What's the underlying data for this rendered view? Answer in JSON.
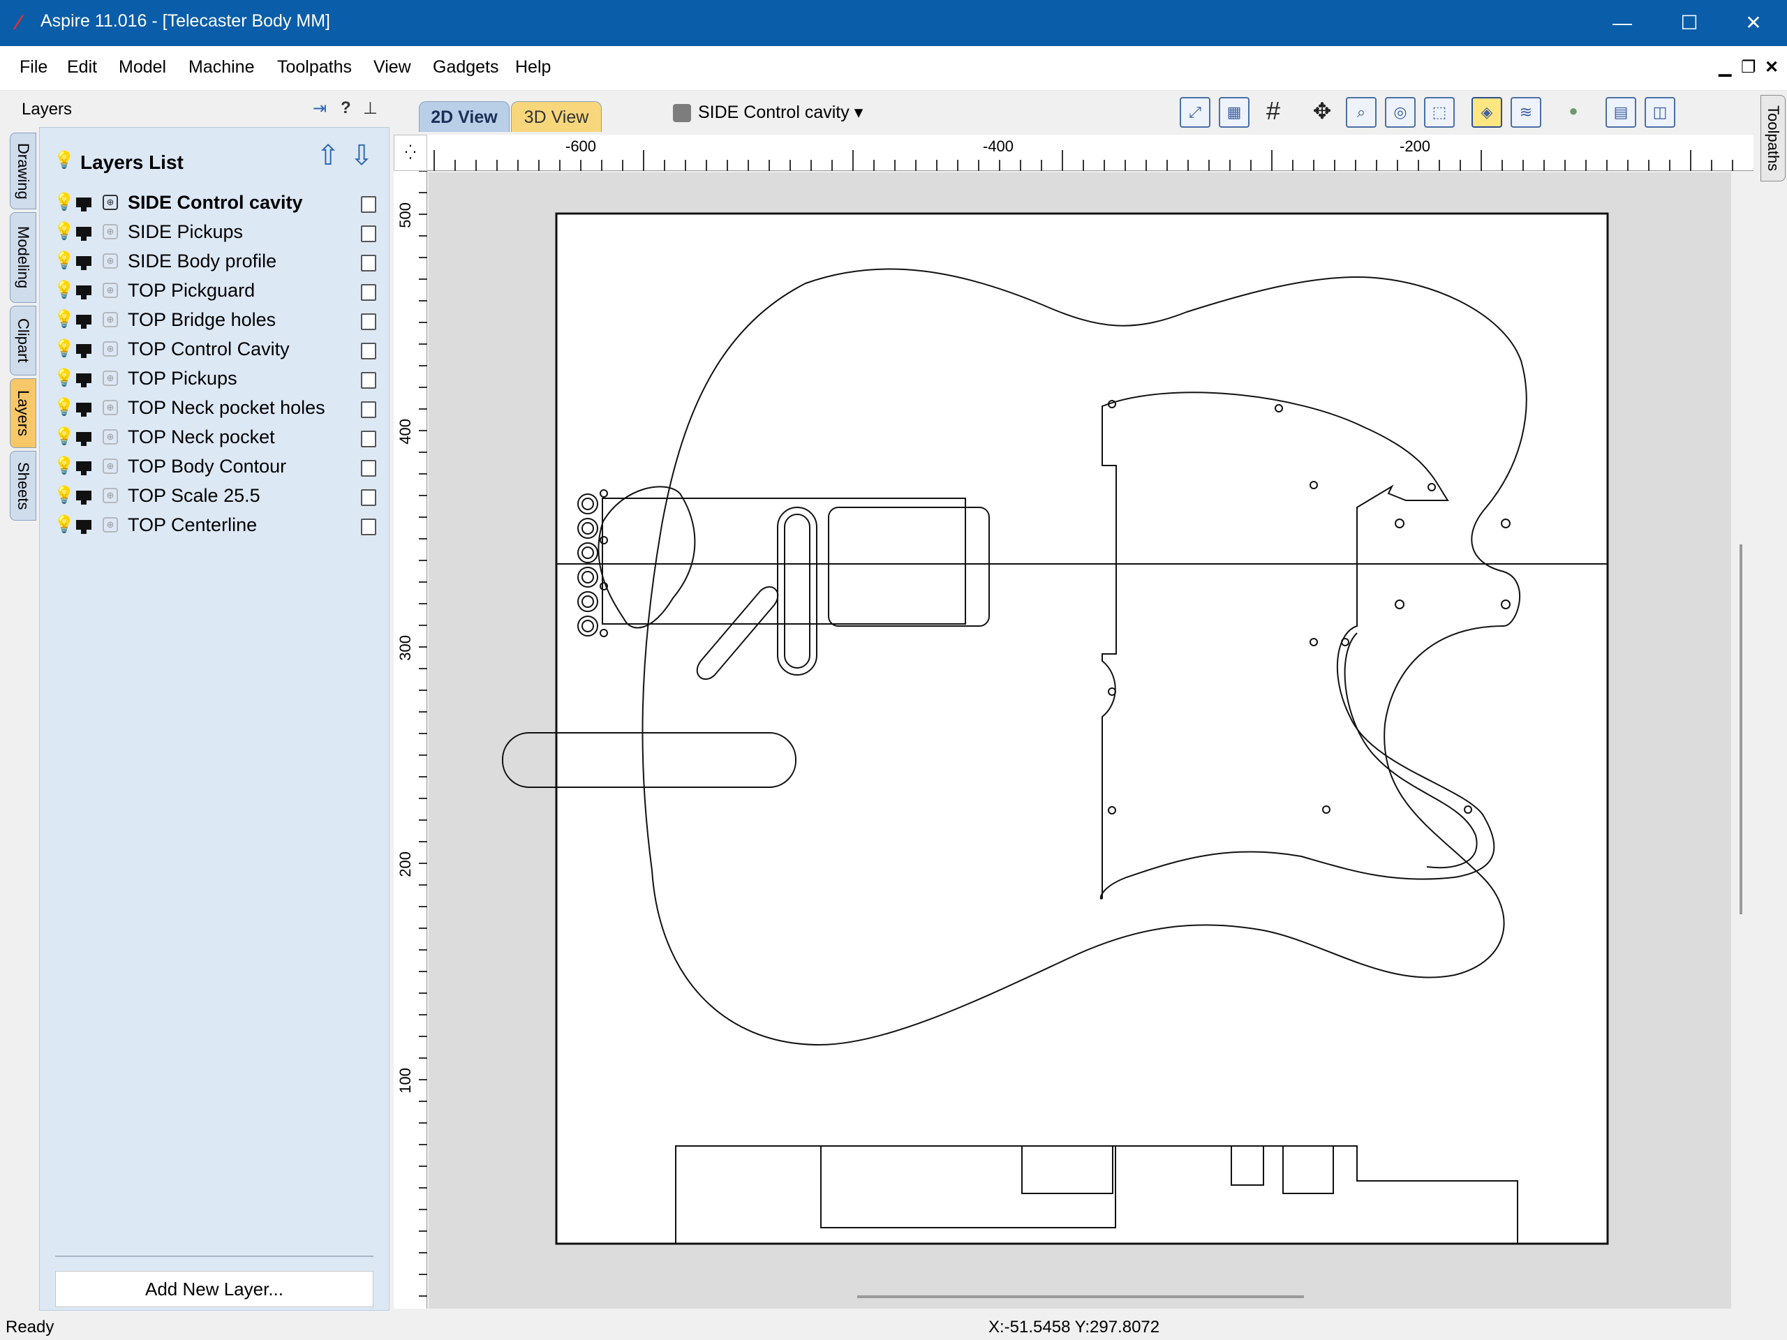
{
  "window": {
    "title": "Aspire 11.016 - [Telecaster Body MM]",
    "app_icon": "aspire-logo-icon",
    "controls": [
      "minimize-icon",
      "maximize-icon",
      "close-icon"
    ]
  },
  "menu": {
    "items": [
      "File",
      "Edit",
      "Model",
      "Machine",
      "Toolpaths",
      "View",
      "Gadgets",
      "Help"
    ]
  },
  "layers_panel": {
    "header": "Layers",
    "side_tabs": [
      "Drawing",
      "Modeling",
      "Clipart",
      "Layers",
      "Sheets"
    ],
    "active_side_tab": "Layers",
    "title": "Layers List",
    "layers": [
      {
        "name": "SIDE Control cavity",
        "active": true
      },
      {
        "name": "SIDE Pickups",
        "active": false
      },
      {
        "name": "SIDE Body profile",
        "active": false
      },
      {
        "name": "TOP Pickguard",
        "active": false
      },
      {
        "name": "TOP Bridge holes",
        "active": false
      },
      {
        "name": "TOP Control Cavity",
        "active": false
      },
      {
        "name": "TOP Pickups",
        "active": false
      },
      {
        "name": "TOP Neck pocket holes",
        "active": false
      },
      {
        "name": "TOP Neck pocket",
        "active": false
      },
      {
        "name": "TOP Body Contour",
        "active": false
      },
      {
        "name": "TOP Scale 25.5",
        "active": false
      },
      {
        "name": "TOP Centerline",
        "active": false
      }
    ],
    "add_button": "Add New Layer..."
  },
  "view_toolbar": {
    "tabs": [
      "2D View",
      "3D View"
    ],
    "active_tab": "2D View",
    "layer_dropdown": "SIDE Control cavity"
  },
  "right_tab": "Toolpaths",
  "rulers": {
    "h_labels": [
      "-600",
      "-400",
      "-200"
    ],
    "v_labels": [
      "500",
      "400",
      "300",
      "200",
      "100"
    ]
  },
  "status": {
    "text": "Ready",
    "coords": "X:-51.5458 Y:297.8072"
  }
}
